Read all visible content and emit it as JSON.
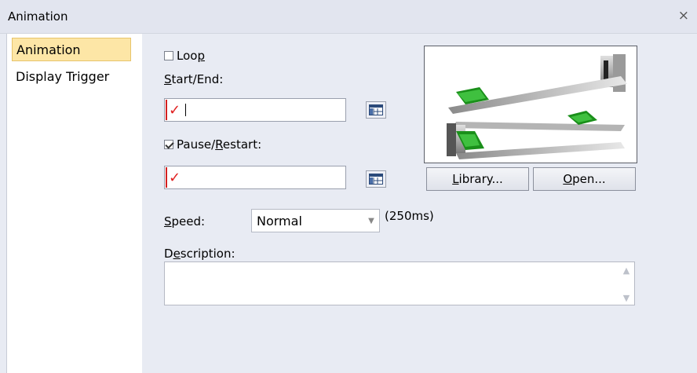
{
  "window": {
    "title": "Animation",
    "close_glyph": "×"
  },
  "nav": {
    "items": [
      {
        "label": "Animation",
        "selected": true
      },
      {
        "label": "Display Trigger",
        "selected": false
      }
    ]
  },
  "loop": {
    "label_prefix": "Loo",
    "label_mnemonic": "p",
    "checked": false
  },
  "start_end": {
    "label_mnemonic": "S",
    "label_rest": "tart/End:",
    "value": ""
  },
  "pause_restart": {
    "label_prefix": "Pause/",
    "label_mnemonic": "R",
    "label_rest": "estart:",
    "checked": true,
    "value": ""
  },
  "buttons": {
    "library": {
      "mnemonic": "L",
      "rest": "ibrary..."
    },
    "open": {
      "mnemonic": "O",
      "rest": "pen..."
    }
  },
  "speed": {
    "label_mnemonic": "S",
    "label_rest": "peed:",
    "value": "Normal",
    "hint": "(250ms)"
  },
  "description": {
    "label_prefix": "D",
    "label_mnemonic": "e",
    "label_rest": "scription:",
    "value": ""
  },
  "icons": {
    "close": "close-icon",
    "checkmark": "checkmark-icon",
    "browse": "table-icon",
    "dropdown": "chevron-down-icon"
  },
  "colors": {
    "accent_red": "#d42020",
    "selected_bg": "#fde6a6"
  }
}
